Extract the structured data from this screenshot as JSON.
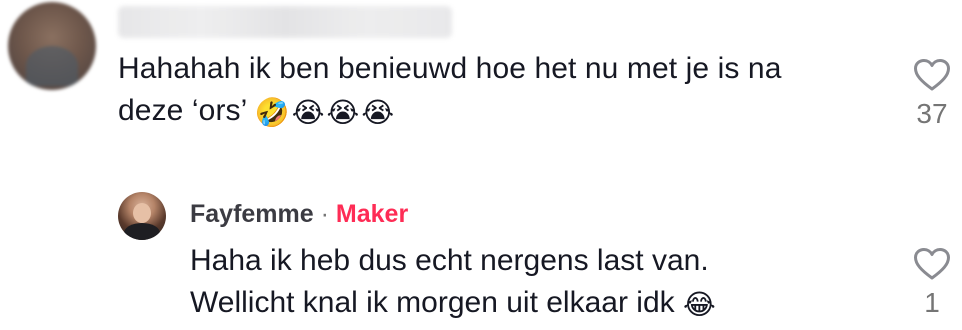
{
  "comment": {
    "text_line1": "Hahahah ik ben benieuwd hoe het nu met je is na",
    "text_line2": "deze ‘ors’",
    "emojis": [
      "🤣",
      "😭",
      "😭",
      "😭"
    ],
    "likes": "37",
    "like_icon": "heart-outline-icon"
  },
  "reply": {
    "author": "Fayfemme",
    "separator": "·",
    "badge": "Maker",
    "badge_color": "#fe2c55",
    "text_line1": "Haha ik heb dus echt nergens last van.",
    "text_line2": "Wellicht knal ik morgen uit elkaar idk",
    "emoji": "😂",
    "likes": "1",
    "like_icon": "heart-outline-icon"
  }
}
